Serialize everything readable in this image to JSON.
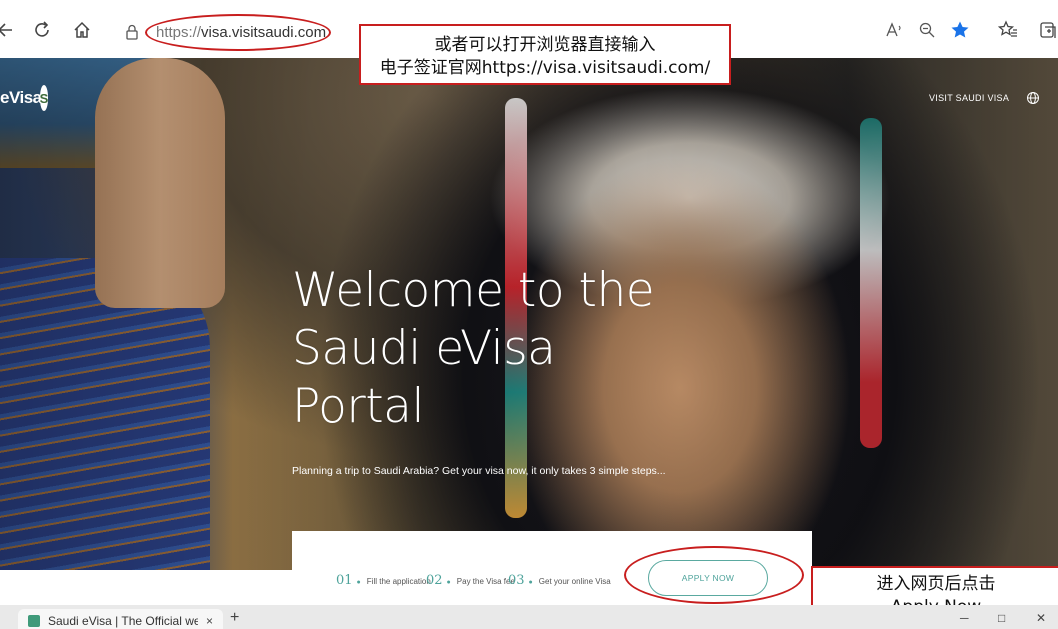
{
  "browser": {
    "url_scheme": "https://",
    "url_host": "visa.visitsaudi.com",
    "icons": [
      "back-arrow-icon",
      "refresh-icon",
      "home-icon",
      "lock-icon",
      "read-aloud-icon",
      "zoom-icon",
      "favorite-star-icon",
      "favorites-list-icon",
      "collections-icon"
    ]
  },
  "annotations": {
    "top_note_line1": "或者可以打开浏览器直接输入",
    "top_note_line2": "电子签证官网https://visa.visitsaudi.com/",
    "bottom_note_line1": "进入网页后点击",
    "bottom_note_line2": "Apply Now",
    "highlight_color": "#c81e1e"
  },
  "site": {
    "logo_text": "eVisa",
    "logo_badge": "S",
    "nav_link": "VISIT SAUDI VISA",
    "hero_title": [
      "Welcome to the",
      "Saudi eVisa",
      "Portal"
    ],
    "hero_subtitle": "Planning a trip to Saudi Arabia? Get your visa now, it only takes 3 simple steps...",
    "steps": [
      {
        "num": "01",
        "label": "Fill the application"
      },
      {
        "num": "02",
        "label": "Pay the Visa fee"
      },
      {
        "num": "03",
        "label": "Get your online Visa"
      }
    ],
    "apply_label": "APPLY NOW",
    "accent_color": "#4ea39b"
  },
  "tabs": {
    "active_title": "Saudi eVisa | The Official websit",
    "close": "×",
    "new_tab": "+"
  }
}
